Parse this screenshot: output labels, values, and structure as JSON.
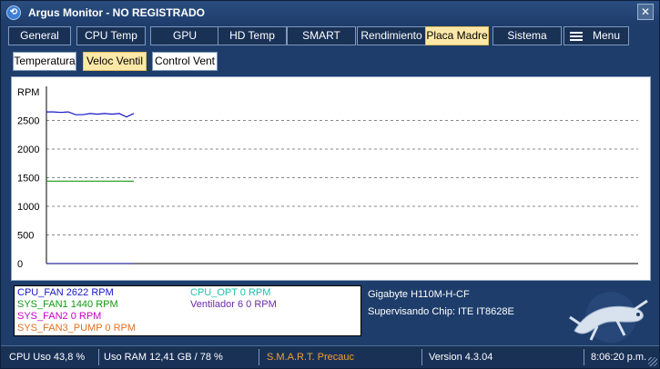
{
  "window": {
    "title": "Argus Monitor - NO REGISTRADO",
    "close_glyph": "✕"
  },
  "tabs": [
    {
      "label": "General"
    },
    {
      "label": "CPU Temp"
    },
    {
      "label": "GPU"
    },
    {
      "label": "HD Temp"
    },
    {
      "label": "SMART"
    },
    {
      "label": "Rendimiento"
    },
    {
      "label": "Placa Madre"
    },
    {
      "label": "Sistema"
    },
    {
      "label": "Menu"
    }
  ],
  "subtabs": [
    {
      "label": "Temperatura"
    },
    {
      "label": "Veloc Ventil"
    },
    {
      "label": "Control Vent"
    }
  ],
  "chart_data": {
    "type": "line",
    "ylabel": "RPM",
    "ylim": [
      0,
      3000
    ],
    "yticks": [
      0,
      500,
      1000,
      1500,
      2000,
      2500
    ],
    "grid": "horizontal-dashed",
    "series": [
      {
        "name": "CPU_FAN",
        "color": "#1515c8",
        "values": [
          2650,
          2650,
          2640,
          2650,
          2600,
          2600,
          2620,
          2610,
          2620,
          2610,
          2620,
          2560,
          2622
        ]
      },
      {
        "name": "SYS_FAN1",
        "color": "#139a13",
        "values": [
          1440,
          1440,
          1440,
          1440,
          1440,
          1440,
          1440,
          1440,
          1440,
          1440,
          1440,
          1440,
          1440
        ]
      },
      {
        "name": "SYS_FAN3_PUMP",
        "color": "#2a2aa0",
        "values": [
          0,
          0,
          0,
          0,
          0,
          0,
          0,
          0,
          0,
          0,
          0,
          0,
          0
        ]
      }
    ]
  },
  "legend": [
    {
      "text": "CPU_FAN 2622 RPM",
      "color": "#1515c8"
    },
    {
      "text": "SYS_FAN1 1440 RPM",
      "color": "#139a13"
    },
    {
      "text": "SYS_FAN2 0 RPM",
      "color": "#c800c8"
    },
    {
      "text": "SYS_FAN3_PUMP 0 RPM",
      "color": "#e07020"
    },
    {
      "text": "CPU_OPT 0 RPM",
      "color": "#20c0b0"
    },
    {
      "text": "Ventilador 6 0 RPM",
      "color": "#6a2aa8"
    }
  ],
  "info": {
    "board": "Gigabyte H110M-H-CF",
    "chip": "Supervisando Chip: ITE IT8628E"
  },
  "status": {
    "cpu": "CPU Uso 43,8 %",
    "ram": "Uso RAM 12,41 GB / 78 %",
    "smart": "S.M.A.R.T. Precauc",
    "smart_color": "#f0a030",
    "version": "Version 4.3.04",
    "time": "8:06:20 p.m."
  }
}
